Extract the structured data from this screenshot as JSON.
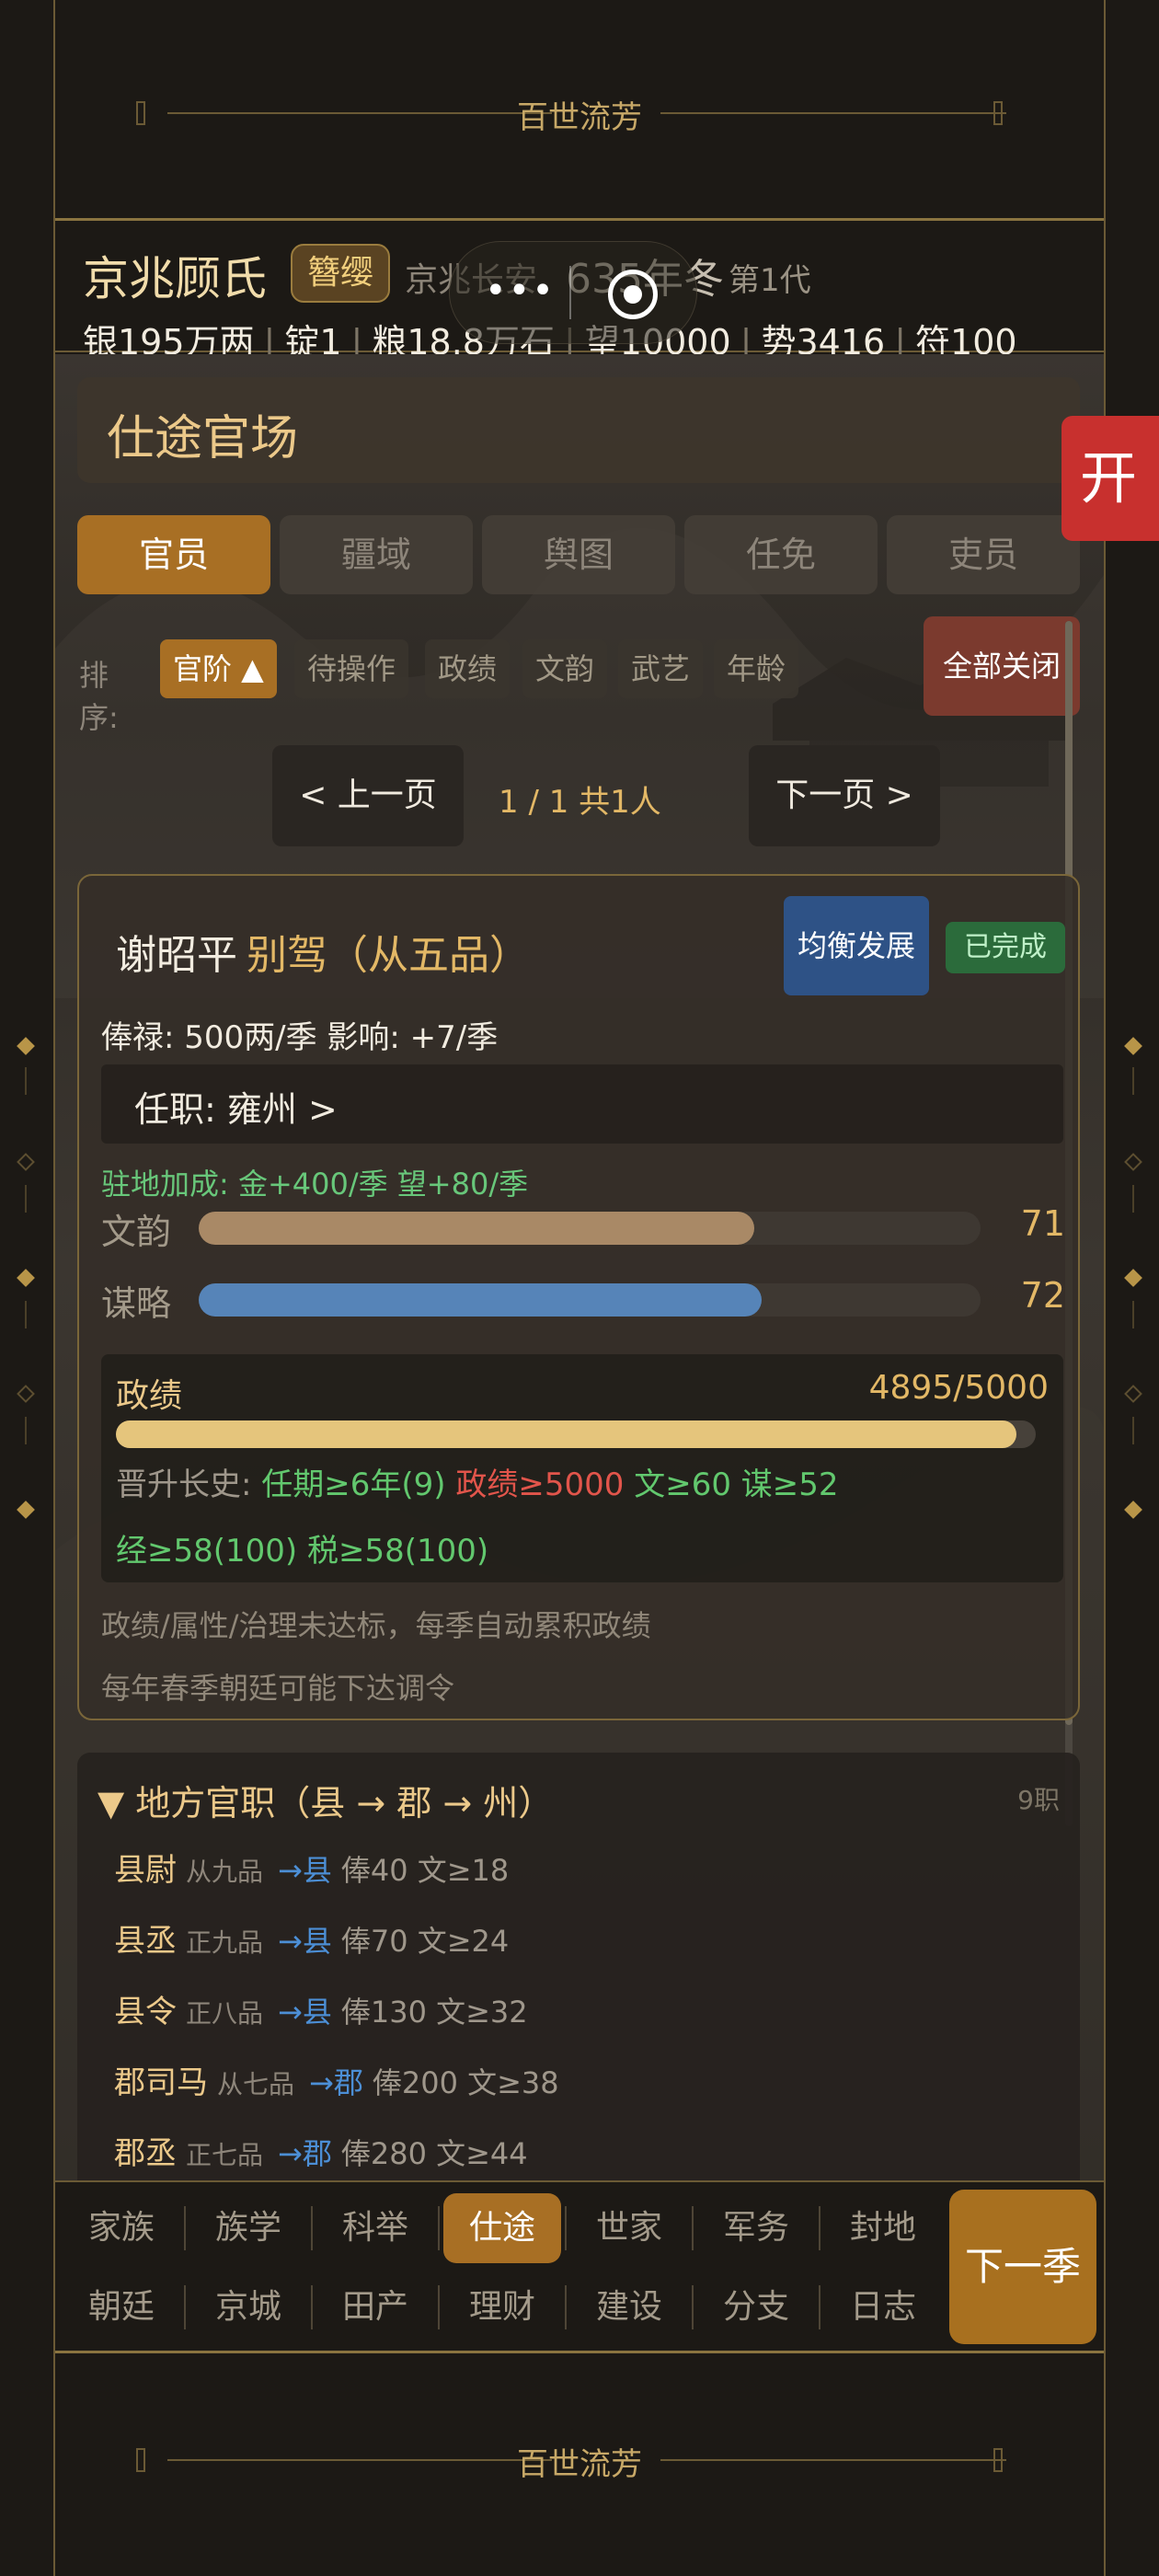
{
  "banner": {
    "title": "百世流芳"
  },
  "header": {
    "clan": "京兆顾氏",
    "rank_badge": "簪缨",
    "place": "京兆长安",
    "year": "635年冬",
    "generation": "第1代",
    "resources": [
      "银195万两",
      "锭1",
      "粮18.8万石",
      "望10000",
      "势3416",
      "符100"
    ]
  },
  "section": {
    "title": "仕途官场"
  },
  "tabs": [
    {
      "label": "官员",
      "active": true
    },
    {
      "label": "疆域",
      "active": false
    },
    {
      "label": "舆图",
      "active": false
    },
    {
      "label": "任免",
      "active": false
    },
    {
      "label": "吏员",
      "active": false
    }
  ],
  "sort": {
    "label": "排序:",
    "options": [
      "官阶 ▲",
      "待操作",
      "政绩",
      "文韵",
      "武艺",
      "年龄"
    ],
    "close_all": "全部关闭"
  },
  "pager": {
    "prev": "< 上一页",
    "info": "1 / 1  共1人",
    "next": "下一页 >"
  },
  "official": {
    "name": "谢昭平",
    "post": "别驾（从五品）",
    "strategy": "均衡发展",
    "status": "已完成",
    "salary_line": "俸禄: 500两/季   影响: +7/季",
    "assignment": "任职: 雍州  >",
    "bonus": "驻地加成: 金+400/季  望+80/季",
    "stats": [
      {
        "label": "文韵",
        "value": "71",
        "fraction": 0.71,
        "color": "#a98966"
      },
      {
        "label": "谋略",
        "value": "72",
        "fraction": 0.72,
        "color": "#5684b8"
      }
    ],
    "merit": {
      "title": "政绩",
      "value": "4895/5000",
      "fraction": 0.979,
      "promo_label": "晋升长史:",
      "req_term": "任期≥6年(9)",
      "req_merit": "政绩≥5000",
      "req_wen": "文≥60",
      "req_mou": "谋≥52",
      "req_jing": "经≥58(100)",
      "req_shui": "税≥58(100)"
    },
    "note1": "政绩/属性/治理未达标，每季自动累积政绩",
    "note2": "每年春季朝廷可能下达调令"
  },
  "ranks": {
    "title": "▼ 地方官职（县 → 郡 → 州）",
    "count": "9职",
    "rows": [
      {
        "name": "县尉",
        "grade": "从九品",
        "level": "→县",
        "detail": "俸40 文≥18"
      },
      {
        "name": "县丞",
        "grade": "正九品",
        "level": "→县",
        "detail": "俸70 文≥24"
      },
      {
        "name": "县令",
        "grade": "正八品",
        "level": "→县",
        "detail": "俸130 文≥32"
      },
      {
        "name": "郡司马",
        "grade": "从七品",
        "level": "→郡",
        "detail": "俸200 文≥38"
      },
      {
        "name": "郡丞",
        "grade": "正七品",
        "level": "→郡",
        "detail": "俸280 文≥44"
      }
    ]
  },
  "nav": {
    "row1": [
      "家族",
      "族学",
      "科举",
      "仕途",
      "世家",
      "军务",
      "封地"
    ],
    "row2": [
      "朝廷",
      "京城",
      "田产",
      "理财",
      "建设",
      "分支",
      "日志"
    ],
    "active": "仕途",
    "next_season": "下一季"
  },
  "float_button": "开"
}
